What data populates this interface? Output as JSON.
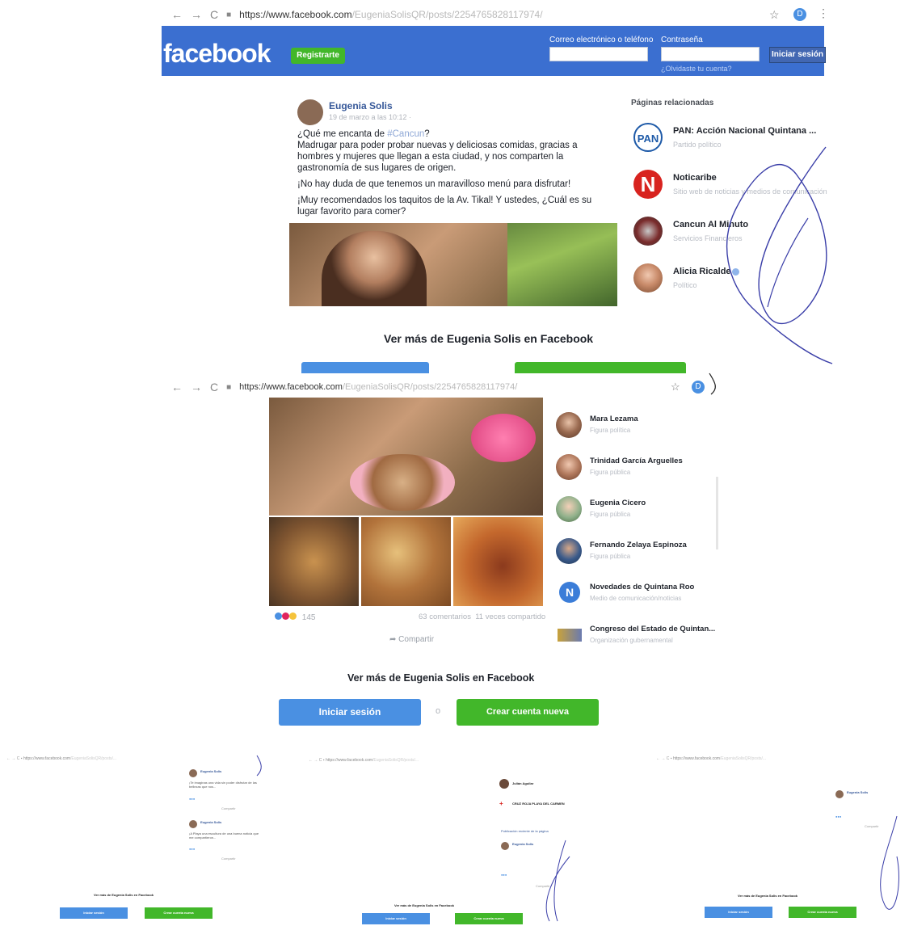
{
  "screen1": {
    "nav": {
      "back": "←",
      "forward": "→",
      "reload": "C",
      "lock": "🔒"
    },
    "url": {
      "host": "https://www.facebook.com",
      "path": "/EugeniaSolisQR/posts/2254765828117974/"
    },
    "star": "☆",
    "profile": "D",
    "header": {
      "logo": "facebook",
      "register": "Registrarte",
      "email_label": "Correo electrónico o teléfono",
      "password_label": "Contraseña",
      "login": "Iniciar sesión",
      "forgot": "¿Olvidaste tu cuenta?"
    },
    "post": {
      "author": "Eugenia Solis",
      "time": "19 de marzo a las 10:12 ·",
      "p1_a": "¿Qué me encanta de ",
      "p1_tag": "#Cancun",
      "p1_b": "?",
      "p2": "Madrugar para poder probar nuevas y deliciosas comidas, gracias a hombres y mujeres que llegan a esta ciudad, y nos comparten la gastronomía de sus lugares de origen.",
      "p3": "¡No hay duda de que tenemos un maravilloso menú para disfrutar!",
      "p4": "¡Muy recomendados los taquitos de la Av. Tikal! Y ustedes, ¿Cuál es su lugar favorito para comer?"
    },
    "related": {
      "title": "Páginas relacionadas",
      "items": [
        {
          "name": "PAN: Acción Nacional Quintana ...",
          "sub": "Partido político",
          "logo": "PAN"
        },
        {
          "name": "Noticaribe",
          "sub": "Sitio web de noticias y medios de comunicación",
          "logo": "N"
        },
        {
          "name": "Cancun Al Minuto",
          "sub": "Servicios Financieros"
        },
        {
          "name": "Alicia Ricalde",
          "sub": "Político"
        }
      ]
    },
    "more": "Ver más de Eugenia Solis en Facebook"
  },
  "screen2": {
    "url": {
      "host": "https://www.facebook.com",
      "path": "/EugeniaSolisQR/posts/2254765828117974/"
    },
    "reactions": "145",
    "stats": "63 comentarios  11 veces compartido",
    "share": "Compartir",
    "people": [
      {
        "name": "Mara Lezama",
        "sub": "Figura política"
      },
      {
        "name": "Trinidad García Arguelles",
        "sub": "Figura pública"
      },
      {
        "name": "Eugenia Cicero",
        "sub": "Figura pública"
      },
      {
        "name": "Fernando Zelaya Espinoza",
        "sub": "Figura pública"
      },
      {
        "name": "Novedades de Quintana Roo",
        "sub": "Medio de comunicación/noticias",
        "logo": "N"
      },
      {
        "name": "Congreso del Estado de Quintan...",
        "sub": "Organización gubernamental"
      }
    ],
    "more": "Ver más de Eugenia Solis en Facebook",
    "login": "Iniciar sesión",
    "or": "o",
    "create": "Crear cuenta nueva"
  },
  "mini": [
    {
      "author": "Eugenia Solis",
      "text1": "¡Te imaginas una vida sin poder disfrutar de las bellezas que nos...",
      "text2": "¡A Playa una escultura de una buena noticia que me compartieron...",
      "share": "Compartir",
      "more": "Ver más de Eugenia Solis en Facebook",
      "login": "Iniciar sesión",
      "create": "Crear cuenta nueva"
    },
    {
      "author1": "Julián Aguilar",
      "author2": "CRUZ ROJA PLAYA DEL CARMEN",
      "recent": "Publicación reciente de la página",
      "author": "Eugenia Solis",
      "share": "Compartir",
      "more": "Ver más de Eugenia Solis en Facebook",
      "login": "Iniciar sesión",
      "create": "Crear cuenta nueva"
    },
    {
      "author": "Eugenia Solis",
      "share": "Compartir",
      "more": "Ver más de Eugenia Solis en Facebook",
      "login": "Iniciar sesión",
      "create": "Crear cuenta nueva"
    }
  ]
}
